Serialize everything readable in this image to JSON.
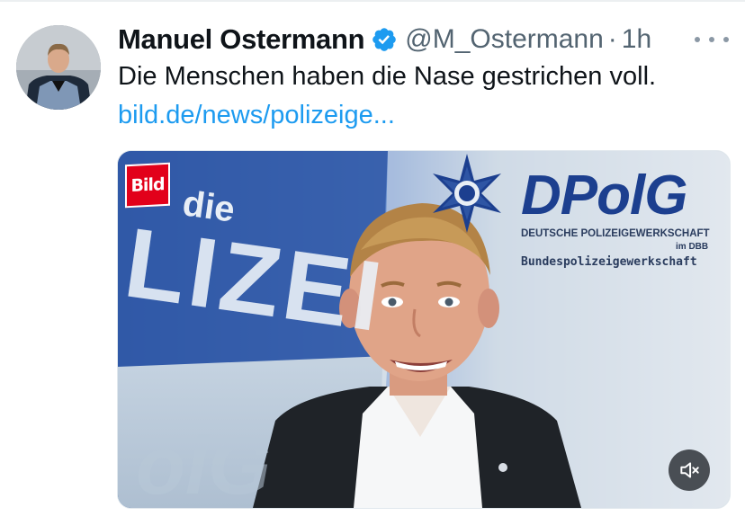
{
  "tweet": {
    "author_name": "Manuel Ostermann",
    "handle": "@M_Ostermann",
    "separator": "·",
    "time": "1h",
    "text": "Die Menschen haben die Nase gestrichen voll.",
    "link": "bild.de/news/polizeige..."
  },
  "media": {
    "brand_logo": "Bild",
    "background_text_1": "die",
    "background_text_2": "LIZEI",
    "background_text_3": "olG",
    "org_logo": "DPolG",
    "org_line_1": "DEUTSCHE POLIZEIGEWERKSCHAFT",
    "org_line_2": "im DBB",
    "org_line_3": "Bundespolizeigewerkschaft",
    "mute_icon": "volume-muted-icon"
  },
  "icons": {
    "verified": "verified-badge-icon",
    "more": "more-options-icon"
  },
  "colors": {
    "link": "#1d9bf0",
    "verified": "#1d9bf0",
    "secondary_text": "#536471",
    "bild_red": "#e2001a",
    "dpolg_blue": "#1c3f8f"
  }
}
